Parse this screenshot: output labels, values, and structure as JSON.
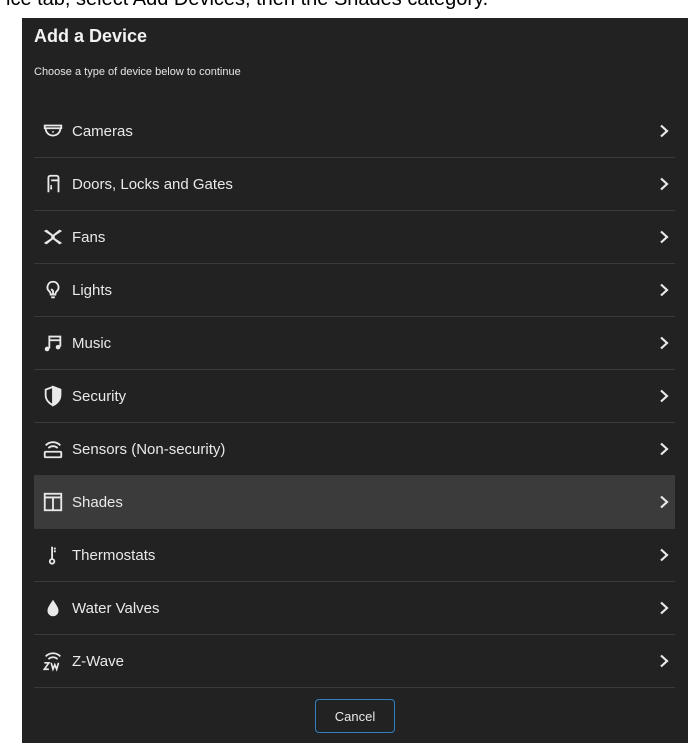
{
  "caption": "ice tab, select Add Devices, then the Shades category.",
  "dialog": {
    "title": "Add a Device",
    "subtitle": "Choose a type of device below to continue",
    "cancel_label": "Cancel"
  },
  "items": [
    {
      "label": "Cameras",
      "icon": "camera-icon",
      "selected": false
    },
    {
      "label": "Doors, Locks and Gates",
      "icon": "door-lock-icon",
      "selected": false
    },
    {
      "label": "Fans",
      "icon": "fan-icon",
      "selected": false
    },
    {
      "label": "Lights",
      "icon": "lightbulb-icon",
      "selected": false
    },
    {
      "label": "Music",
      "icon": "music-icon",
      "selected": false
    },
    {
      "label": "Security",
      "icon": "shield-icon",
      "selected": false
    },
    {
      "label": "Sensors (Non-security)",
      "icon": "sensor-icon",
      "selected": false
    },
    {
      "label": "Shades",
      "icon": "shades-icon",
      "selected": true
    },
    {
      "label": "Thermostats",
      "icon": "thermometer-icon",
      "selected": false
    },
    {
      "label": "Water Valves",
      "icon": "water-drop-icon",
      "selected": false
    },
    {
      "label": "Z-Wave",
      "icon": "zwave-icon",
      "selected": false
    }
  ],
  "colors": {
    "dialog_bg": "#222222",
    "selected_row_bg": "#3b3b3b",
    "button_border": "#2f7fc1",
    "text": "#e9e9e9"
  }
}
